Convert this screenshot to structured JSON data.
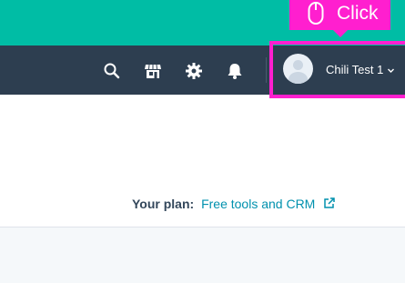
{
  "navbar": {
    "icons": [
      "search-icon",
      "marketplace-icon",
      "settings-gear-icon",
      "notifications-bell-icon"
    ],
    "account": {
      "name": "Chili Test 1",
      "avatar_icon": "default-user-avatar"
    }
  },
  "annotation": {
    "label": "Click",
    "icon": "mouse-icon",
    "color": "#ff1fcf"
  },
  "plan": {
    "label": "Your plan:",
    "link_text": "Free tools and CRM",
    "link_icon": "external-link-icon"
  },
  "colors": {
    "top_band": "#00bda5",
    "navbar": "#2d3e50",
    "link": "#0091ae",
    "text": "#33475b"
  }
}
